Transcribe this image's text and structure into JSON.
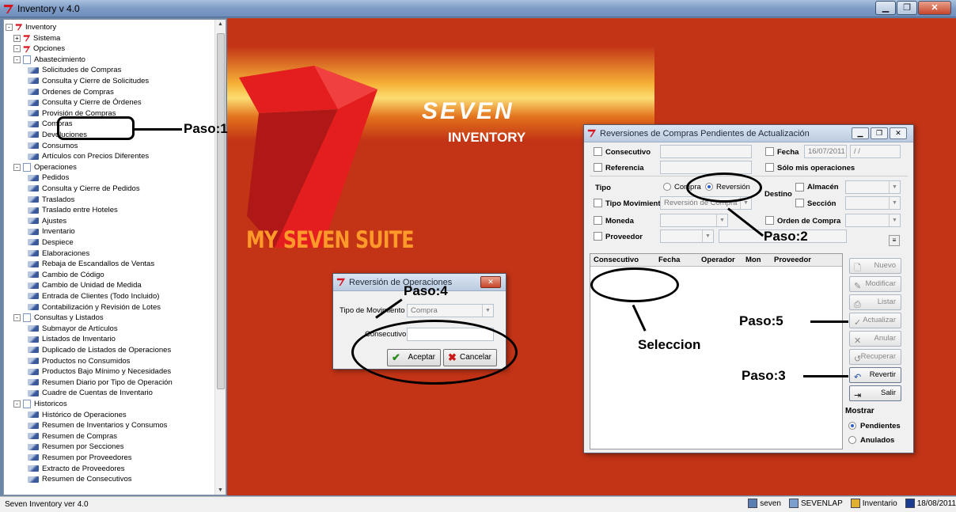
{
  "window": {
    "title": "Inventory v 4.0"
  },
  "tree": {
    "items": [
      {
        "label": "Inventory",
        "level": 0,
        "icon": "seven-logo-icon",
        "exp": "-"
      },
      {
        "label": "Sistema",
        "level": 1,
        "icon": "seven-logo-icon",
        "exp": "+"
      },
      {
        "label": "Opciones",
        "level": 1,
        "icon": "seven-logo-icon",
        "exp": "-"
      },
      {
        "label": "Abastecimiento",
        "level": 2,
        "icon": "folder-icon",
        "exp": "-"
      },
      {
        "label": "Solicitudes de Compras",
        "level": 3,
        "icon": "form-icon"
      },
      {
        "label": "Consulta y Cierre de Solicitudes",
        "level": 3,
        "icon": "form-icon"
      },
      {
        "label": "Ordenes de Compras",
        "level": 3,
        "icon": "form-icon"
      },
      {
        "label": "Consulta y Cierre de Órdenes",
        "level": 3,
        "icon": "form-icon"
      },
      {
        "label": "Provisión de Compras",
        "level": 3,
        "icon": "form-icon"
      },
      {
        "label": "Compras",
        "level": 3,
        "icon": "form-icon"
      },
      {
        "label": "Devoluciones",
        "level": 3,
        "icon": "form-icon"
      },
      {
        "label": "Consumos",
        "level": 3,
        "icon": "form-icon"
      },
      {
        "label": "Artículos con Precios Diferentes",
        "level": 3,
        "icon": "form-icon"
      },
      {
        "label": "Operaciones",
        "level": 2,
        "icon": "folder-icon",
        "exp": "-"
      },
      {
        "label": "Pedidos",
        "level": 3,
        "icon": "form-icon"
      },
      {
        "label": "Consulta y Cierre de Pedidos",
        "level": 3,
        "icon": "form-icon"
      },
      {
        "label": "Traslados",
        "level": 3,
        "icon": "form-icon"
      },
      {
        "label": "Traslado entre Hoteles",
        "level": 3,
        "icon": "form-icon"
      },
      {
        "label": "Ajustes",
        "level": 3,
        "icon": "form-icon"
      },
      {
        "label": "Inventario",
        "level": 3,
        "icon": "form-icon"
      },
      {
        "label": "Despiece",
        "level": 3,
        "icon": "form-icon"
      },
      {
        "label": "Elaboraciones",
        "level": 3,
        "icon": "form-icon"
      },
      {
        "label": "Rebaja de Escandallos de Ventas",
        "level": 3,
        "icon": "form-icon"
      },
      {
        "label": "Cambio de Código",
        "level": 3,
        "icon": "form-icon"
      },
      {
        "label": "Cambio de Unidad de Medida",
        "level": 3,
        "icon": "form-icon"
      },
      {
        "label": "Entrada de Clientes (Todo Incluido)",
        "level": 3,
        "icon": "form-icon"
      },
      {
        "label": "Contabilización y Revisión de Lotes",
        "level": 3,
        "icon": "form-icon"
      },
      {
        "label": "Consultas y Listados",
        "level": 2,
        "icon": "folder-icon",
        "exp": "-"
      },
      {
        "label": "Submayor de Artículos",
        "level": 3,
        "icon": "form-icon"
      },
      {
        "label": "Listados de Inventario",
        "level": 3,
        "icon": "form-icon"
      },
      {
        "label": "Duplicado de Listados de Operaciones",
        "level": 3,
        "icon": "form-icon"
      },
      {
        "label": "Productos no Consumidos",
        "level": 3,
        "icon": "form-icon"
      },
      {
        "label": "Productos Bajo Mínimo y Necesidades",
        "level": 3,
        "icon": "form-icon"
      },
      {
        "label": "Resumen Diario por Tipo de Operación",
        "level": 3,
        "icon": "form-icon"
      },
      {
        "label": "Cuadre de Cuentas de Inventario",
        "level": 3,
        "icon": "form-icon"
      },
      {
        "label": "Historicos",
        "level": 2,
        "icon": "folder-icon",
        "exp": "-"
      },
      {
        "label": "Histórico de Operaciones",
        "level": 3,
        "icon": "form-icon"
      },
      {
        "label": "Resumen de Inventarios y Consumos",
        "level": 3,
        "icon": "form-icon"
      },
      {
        "label": "Resumen de Compras",
        "level": 3,
        "icon": "form-icon"
      },
      {
        "label": "Resumen por Secciones",
        "level": 3,
        "icon": "form-icon"
      },
      {
        "label": "Resumen por Proveedores",
        "level": 3,
        "icon": "form-icon"
      },
      {
        "label": "Extracto de Proveedores",
        "level": 3,
        "icon": "form-icon"
      },
      {
        "label": "Resumen de Consecutivos",
        "level": 3,
        "icon": "form-icon"
      }
    ]
  },
  "branding": {
    "seven": "SEVEN",
    "inventory": "INVENTORY",
    "suite": "MY SEVEN SUITE"
  },
  "reversion_dialog": {
    "title": "Reversión de Operaciones",
    "tipo_label": "Tipo de Movimiento",
    "tipo_value": "Compra",
    "consecutivo_label": "Consecutivo",
    "consecutivo_value": "",
    "accept": "Aceptar",
    "cancel": "Cancelar"
  },
  "reversiones_window": {
    "title": "Reversiones de Compras Pendientes de Actualización",
    "consecutivo": "Consecutivo",
    "fecha": "Fecha",
    "fecha_value": "16/07/2011",
    "fecha_value2": "/ /",
    "referencia": "Referencia",
    "solo_mis": "Sólo mis operaciones",
    "tipo": "Tipo",
    "compra": "Compra",
    "reversion": "Reversión",
    "destino": "Destino",
    "almacen": "Almacén",
    "seccion": "Sección",
    "tipo_movimiento": "Tipo Movimiento",
    "tipo_movimiento_value": "Reversión de Compra",
    "moneda": "Moneda",
    "orden_compra": "Orden de Compra",
    "proveedor": "Proveedor",
    "columns": [
      "Consecutivo",
      "Fecha",
      "Operador",
      "Mon",
      "Proveedor"
    ],
    "buttons": {
      "nuevo": "Nuevo",
      "modificar": "Modificar",
      "listar": "Listar",
      "actualizar": "Actualizar",
      "anular": "Anular",
      "recuperar": "Recuperar",
      "revertir": "Revertir",
      "salir": "Salir"
    },
    "mostrar": "Mostrar",
    "pendientes": "Pendientes",
    "anulados": "Anulados"
  },
  "annotations": {
    "paso1": "Paso:1",
    "paso2": "Paso:2",
    "paso3": "Paso:3",
    "paso4": "Paso:4",
    "paso5": "Paso:5",
    "seleccion": "Seleccion"
  },
  "statusbar": {
    "left": "Seven Inventory ver 4.0",
    "user": "seven",
    "machine": "SEVENLAP",
    "db": "Inventario",
    "date": "18/08/2011"
  },
  "colors": {
    "background": "#c33316",
    "accent": "#ff9a2a",
    "brand_red": "#e02020"
  }
}
